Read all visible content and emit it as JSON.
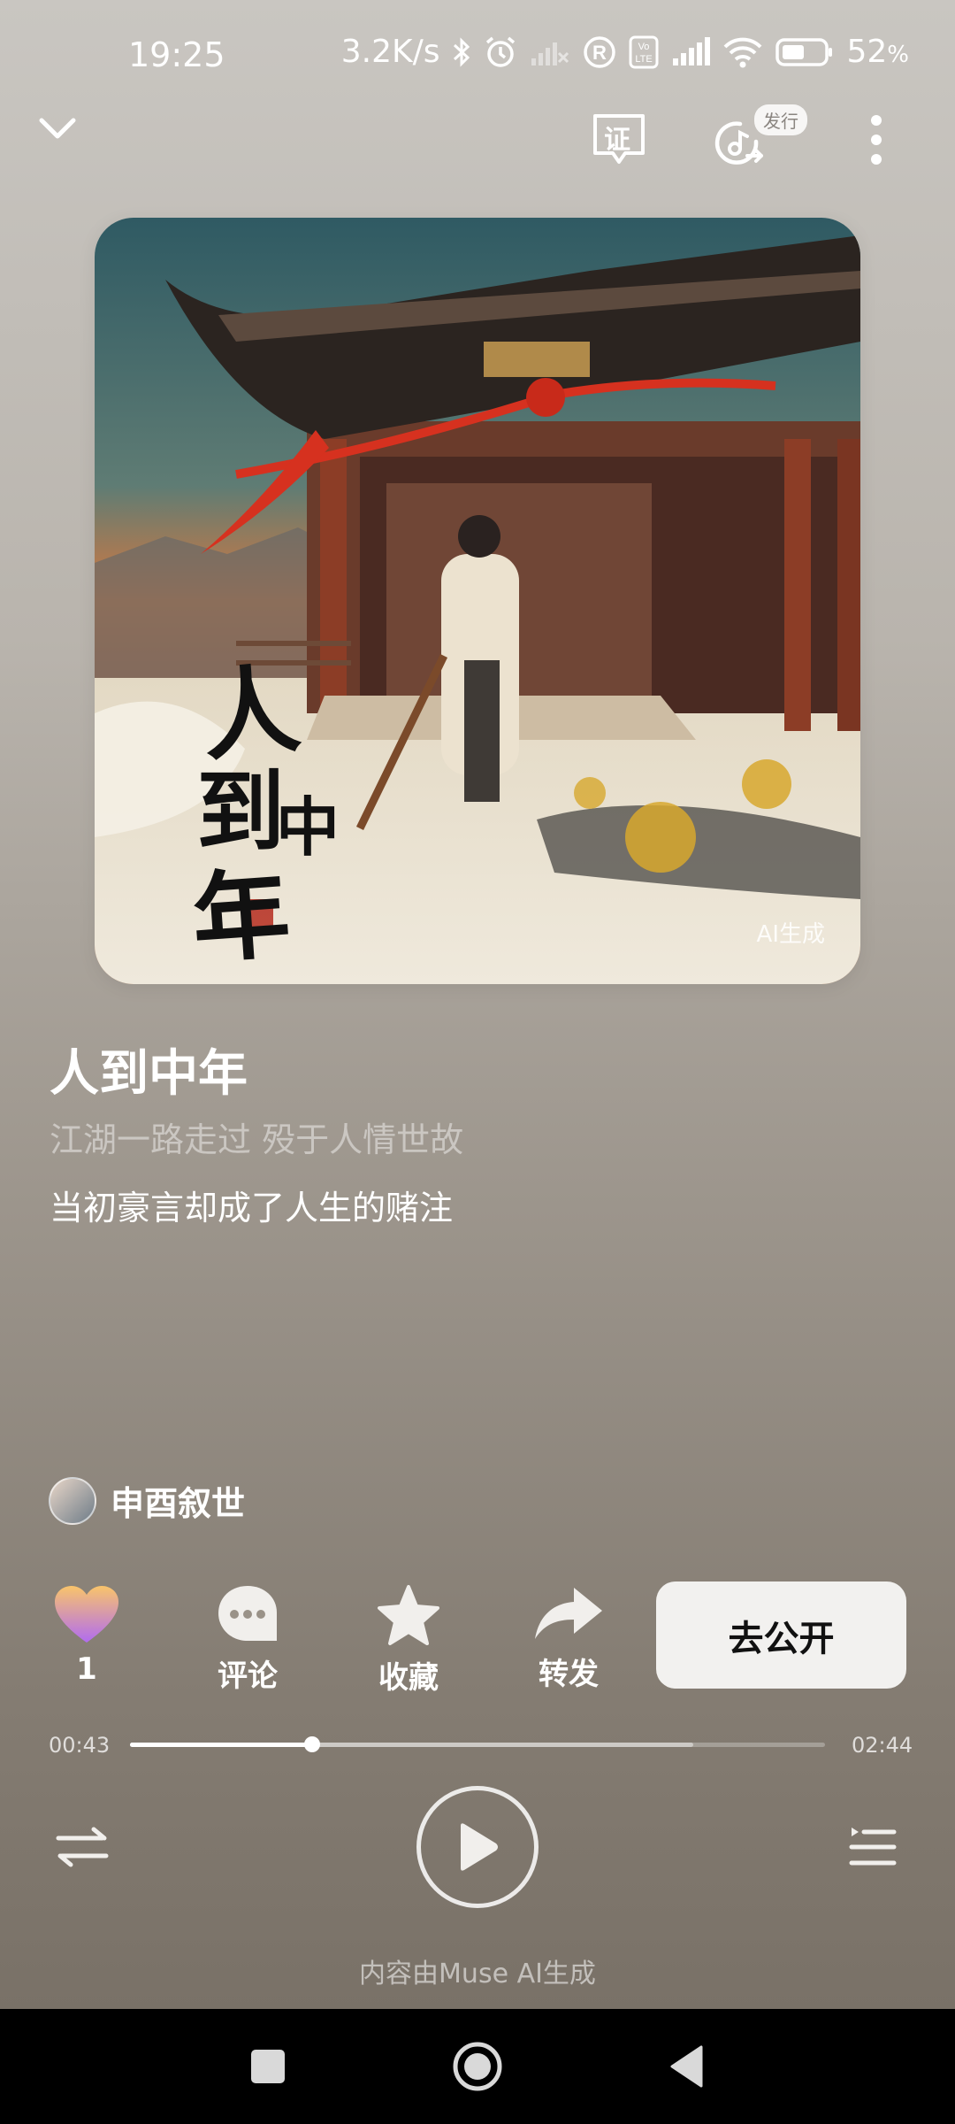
{
  "status": {
    "time": "19:25",
    "net_speed": "3.2K/s",
    "battery": "52",
    "battery_unit": "%",
    "volte": "Vo LTE",
    "icons": [
      "bluetooth-icon",
      "alarm-icon",
      "no-signal-icon",
      "registered-icon",
      "volte-icon",
      "signal-icon",
      "wifi-icon",
      "battery-icon"
    ]
  },
  "topbar": {
    "cert_label": "证",
    "release_badge": "发行"
  },
  "cover": {
    "title_chars": [
      "人",
      "到",
      "中",
      "年"
    ],
    "ai_label": "AI生成"
  },
  "song": {
    "title": "人到中年",
    "lyric_prev": "江湖一路走过 殁于人情世故",
    "lyric_current": "当初豪言却成了人生的赌注"
  },
  "author": {
    "name": "申酉叙世"
  },
  "actions": {
    "like_count": "1",
    "comment_label": "评论",
    "collect_label": "收藏",
    "share_label": "转发",
    "publish_label": "去公开"
  },
  "progress": {
    "current": "00:43",
    "total": "02:44",
    "played_fraction": 0.262,
    "buffered_fraction": 0.81
  },
  "footer": {
    "note": "内容由Muse AI生成"
  },
  "colors": {
    "accent_like_top": "#f9c46b",
    "accent_like_bottom": "#b16cf0",
    "publish_bg": "#f2f1ef"
  }
}
